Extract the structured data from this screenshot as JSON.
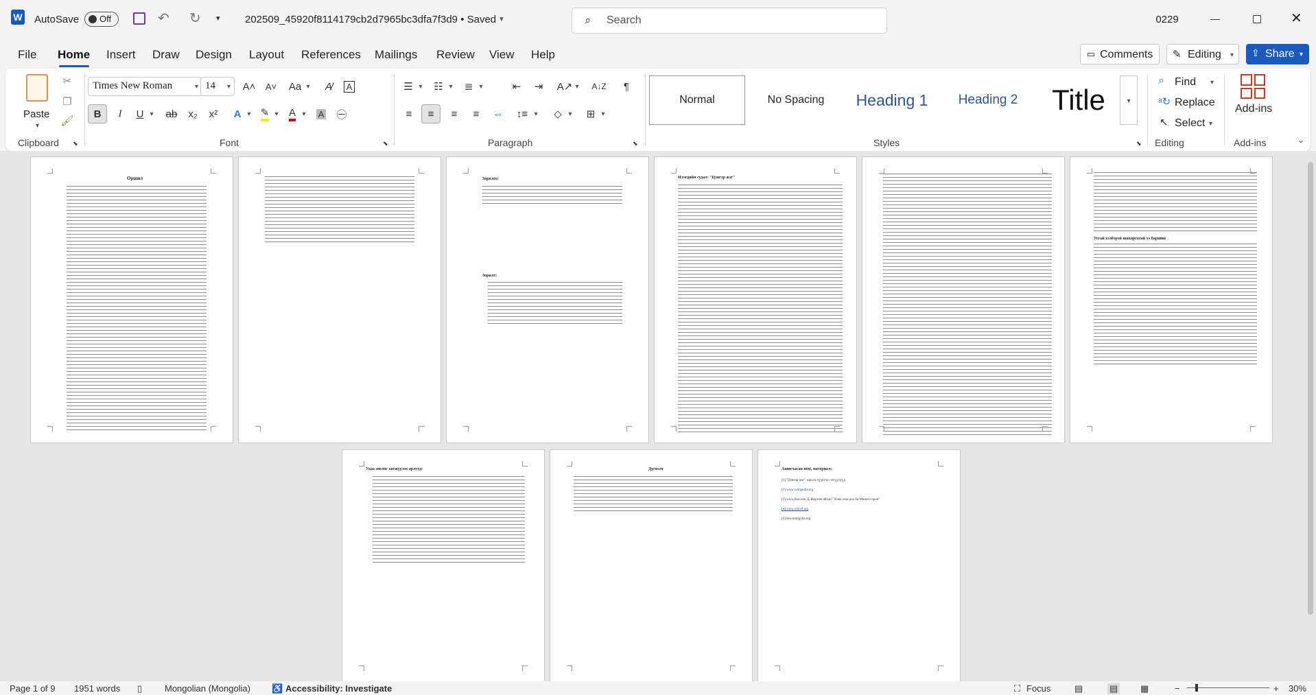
{
  "titlebar": {
    "app_icon": "word-logo-icon",
    "autosave_label": "AutoSave",
    "autosave_state": "Off",
    "doc_title": "202509_45920f8114179cb2d7965bc3dfa7f3d9 • Saved",
    "search_placeholder": "Search",
    "user_badge": "0229",
    "brand_color": "#185abd"
  },
  "tabs": [
    "File",
    "Home",
    "Insert",
    "Draw",
    "Design",
    "Layout",
    "References",
    "Mailings",
    "Review",
    "View",
    "Help"
  ],
  "actions": {
    "comments": "Comments",
    "editing": "Editing",
    "share": "Share"
  },
  "ribbon": {
    "groups": [
      "Clipboard",
      "Font",
      "Paragraph",
      "Styles",
      "Editing",
      "Add-ins"
    ],
    "paste": "Paste",
    "font_name": "Times New Roman",
    "font_size": "14",
    "bold": "B",
    "italic": "I",
    "underline": "U",
    "strike": "ab",
    "subscript": "x₂",
    "superscript": "x²",
    "change_case": "Aa",
    "styles": [
      "Normal",
      "No Spacing",
      "Heading 1",
      "Heading 2",
      "Title"
    ],
    "find": "Find",
    "replace": "Replace",
    "select": "Select",
    "addins": "Add-ins"
  },
  "pages": [
    {
      "title": "Оршил"
    },
    {
      "title": ""
    },
    {
      "title": "Зорилго:",
      "sub": "Зорилт:"
    },
    {
      "title": "Илэгдийн судал: \"Цэнгэр жэг\""
    },
    {
      "title": ""
    },
    {
      "title": "",
      "sub": "Усгай хэлбэрэй шанаргатай хэ баршин"
    },
    {
      "title": "Ухаа зөвлөг хөгжүүлэх арлууд:"
    },
    {
      "title": "Дүгнэлт"
    },
    {
      "title": "Ашигласан ном, материал:",
      "refs": [
        "[1] \"Цэнгэр жэг\" хэрхэх хүүргэх сэтгүүлүүд",
        "[2] www.wikipedia.org",
        "[3] www.ikon.mn Д. Жаргалсайхан \"Усны хомсдол ба Монгол орон\"",
        "[4] www.unicef.org",
        "[5] eeq-mongolia.org"
      ]
    }
  ],
  "status": {
    "page": "Page 1 of 9",
    "words": "1951 words",
    "language": "Mongolian (Mongolia)",
    "accessibility": "Accessibility: Investigate",
    "focus": "Focus",
    "zoom": "30%"
  }
}
